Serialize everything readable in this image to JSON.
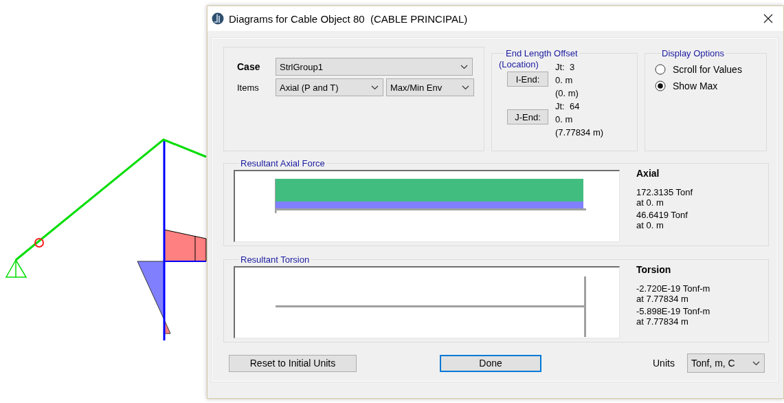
{
  "window": {
    "title": "Diagrams for Cable Object 80  (CABLE PRINCIPAL)"
  },
  "case": {
    "label": "Case",
    "value": "StrlGroup1"
  },
  "items": {
    "label": "Items",
    "component": "Axial (P and T)",
    "envelope": "Max/Min Env"
  },
  "end_length_offset": {
    "title": "End Length Offset",
    "subtitle": "(Location)",
    "ends": [
      {
        "button": "I-End:",
        "joint": "Jt:  3",
        "offset": "0. m",
        "location": "(0. m)"
      },
      {
        "button": "J-End:",
        "joint": "Jt:  64",
        "offset": "0. m",
        "location": "(7.77834 m)"
      }
    ]
  },
  "display_options": {
    "title": "Display Options",
    "options": [
      {
        "label": "Scroll for Values",
        "selected": false
      },
      {
        "label": "Show Max",
        "selected": true
      }
    ]
  },
  "diagrams": [
    {
      "title": "Resultant Axial Force",
      "kind": "axial",
      "heading": "Axial",
      "values": [
        {
          "value": "172.3135 Tonf",
          "at": "at 0. m"
        },
        {
          "value": "46.6419 Tonf",
          "at": "at 0. m"
        }
      ]
    },
    {
      "title": "Resultant Torsion",
      "kind": "torsion",
      "heading": "Torsion",
      "values": [
        {
          "value": "-2.720E-19 Tonf-m",
          "at": "at 7.77834 m"
        },
        {
          "value": "-5.898E-19 Tonf-m",
          "at": "at 7.77834 m"
        }
      ]
    }
  ],
  "buttons": [
    {
      "label": "Reset to Initial Units",
      "focused": false
    },
    {
      "label": "Done",
      "focused": true
    }
  ],
  "units": {
    "label": "Units",
    "value": "Tonf, m, C"
  }
}
